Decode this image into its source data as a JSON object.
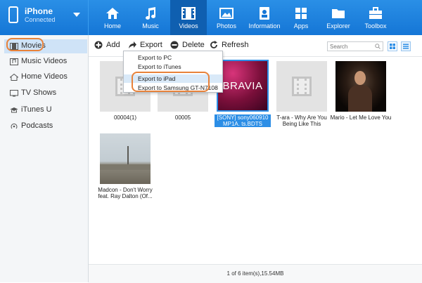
{
  "device": {
    "name": "iPhone",
    "status": "Connected"
  },
  "nav": [
    {
      "label": "Home",
      "icon": "home-icon"
    },
    {
      "label": "Music",
      "icon": "music-icon"
    },
    {
      "label": "Videos",
      "icon": "film-icon"
    },
    {
      "label": "Photos",
      "icon": "photo-icon"
    },
    {
      "label": "Information",
      "icon": "contacts-icon"
    },
    {
      "label": "Apps",
      "icon": "apps-grid-icon"
    },
    {
      "label": "Explorer",
      "icon": "folder-icon"
    },
    {
      "label": "Toolbox",
      "icon": "toolbox-icon"
    }
  ],
  "sidebar": {
    "items": [
      {
        "label": "Movies",
        "icon": "film-strip-icon"
      },
      {
        "label": "Music Videos",
        "icon": "music-video-icon"
      },
      {
        "label": "Home Videos",
        "icon": "home-video-icon"
      },
      {
        "label": "TV Shows",
        "icon": "tv-icon"
      },
      {
        "label": "iTunes U",
        "icon": "graduation-cap-icon"
      },
      {
        "label": "Podcasts",
        "icon": "podcast-icon"
      }
    ]
  },
  "toolbar": {
    "add": "Add",
    "export": "Export",
    "delete": "Delete",
    "refresh": "Refresh",
    "search_placeholder": "Search"
  },
  "export_menu": [
    "Export to PC",
    "Export to iTunes",
    "Export to iPad",
    "Export to Samsung GT-N7108"
  ],
  "videos": [
    {
      "title": "00004(1)"
    },
    {
      "title": "00005"
    },
    {
      "title": "[SONY] sony060910 MP1A. ts.BDTS",
      "thumb_text": "BRAVIA"
    },
    {
      "title": "T-ara - Why Are You Being Like This"
    },
    {
      "title": "Mario - Let Me Love You"
    },
    {
      "title": "Madcon - Don't Worry feat. Ray Dalton (Of..."
    }
  ],
  "footer": {
    "status": "1 of 6 item(s),15.54MB"
  },
  "colors": {
    "accent": "#1a7fdc",
    "highlight": "#e8823a",
    "selection": "#2c8ee6"
  }
}
